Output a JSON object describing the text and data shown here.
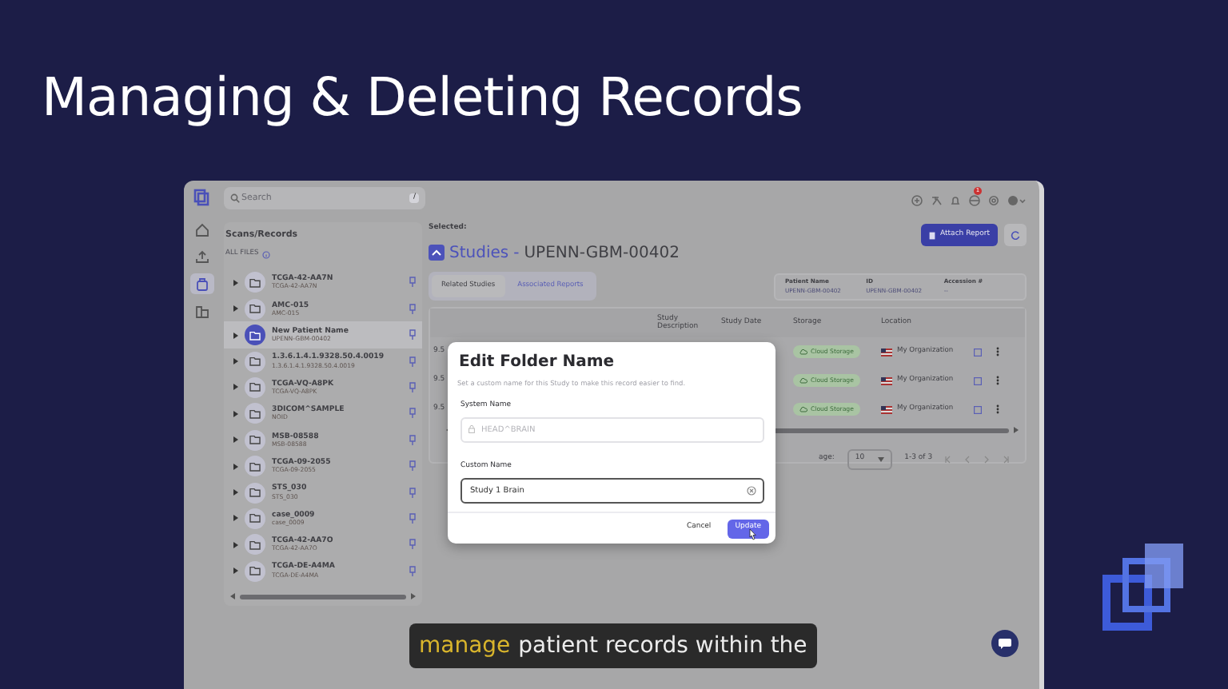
{
  "slide": {
    "title": "Managing & Deleting Records"
  },
  "app": {
    "search": {
      "placeholder": "Search",
      "shortcut": "/"
    },
    "rail": [
      {
        "kind": "home",
        "selected": false
      },
      {
        "kind": "upload",
        "selected": false
      },
      {
        "kind": "records",
        "selected": true
      },
      {
        "kind": "folders",
        "selected": false
      }
    ],
    "notification_count": "1",
    "sidebar": {
      "title": "Scans/Records",
      "filter": "ALL FILES",
      "items": [
        {
          "name": "TCGA-42-AA7N",
          "id": "TCGA-42-AA7N",
          "selected": false
        },
        {
          "name": "AMC-015",
          "id": "AMC-015",
          "selected": false
        },
        {
          "name": "New Patient Name",
          "id": "UPENN-GBM-00402",
          "selected": true
        },
        {
          "name": "1.3.6.1.4.1.9328.50.4.0019",
          "id": "1.3.6.1.4.1.9328.50.4.0019",
          "selected": false
        },
        {
          "name": "TCGA-VQ-A8PK",
          "id": "TCGA-VQ-A8PK",
          "selected": false
        },
        {
          "name": "3DICOM^SAMPLE",
          "id": "NOID",
          "selected": false
        },
        {
          "name": "MSB-08588",
          "id": "MSB-08588",
          "selected": false
        },
        {
          "name": "TCGA-09-2055",
          "id": "TCGA-09-2055",
          "selected": false
        },
        {
          "name": "STS_030",
          "id": "STS_030",
          "selected": false
        },
        {
          "name": "case_0009",
          "id": "case_0009",
          "selected": false
        },
        {
          "name": "TCGA-42-AA7O",
          "id": "TCGA-42-AA7O",
          "selected": false
        },
        {
          "name": "TCGA-DE-A4MA",
          "id": "TCGA-DE-A4MA",
          "selected": false
        }
      ]
    },
    "header": {
      "label": "Selected:",
      "prefix": "Studies",
      "separator": "-",
      "name": "UPENN-GBM-00402",
      "attach_button": "Attach Report"
    },
    "tabs": [
      {
        "label": "Related Studies",
        "selected": true
      },
      {
        "label": "Associated Reports",
        "selected": false
      }
    ],
    "patient_info": [
      {
        "label": "Patient Name",
        "value": "UPENN-GBM-00402"
      },
      {
        "label": "ID",
        "value": "UPENN-GBM-00402"
      },
      {
        "label": "Accession #",
        "value": "--"
      }
    ],
    "table": {
      "columns": [
        "Study Description",
        "Study Date",
        "Storage",
        "Location"
      ],
      "rows": [
        {
          "column_1": "9.5",
          "storage": "Cloud Storage",
          "location": "My Organization"
        },
        {
          "column_1": "9.5",
          "storage": "Cloud Storage",
          "location": "My Organization"
        },
        {
          "column_1": "9.5",
          "storage": "Cloud Storage",
          "location": "My Organization"
        }
      ]
    },
    "pagination": {
      "rows_label": "age:",
      "rows_per_page": "10",
      "range": "1-3 of 3"
    },
    "dialog": {
      "title": "Edit Folder Name",
      "description": "Set a custom name for this Study to make this record easier to find.",
      "fields": [
        {
          "label": "System Name",
          "placeholder": "HEAD^BRAIN",
          "disabled": true
        },
        {
          "label": "Custom Name",
          "value": "Study 1 Brain",
          "disabled": false
        }
      ],
      "buttons": [
        {
          "label": "Cancel",
          "kind": "secondary"
        },
        {
          "label": "Update",
          "kind": "primary"
        }
      ]
    }
  },
  "caption": {
    "highlight": "manage",
    "text": "patient records within the"
  }
}
